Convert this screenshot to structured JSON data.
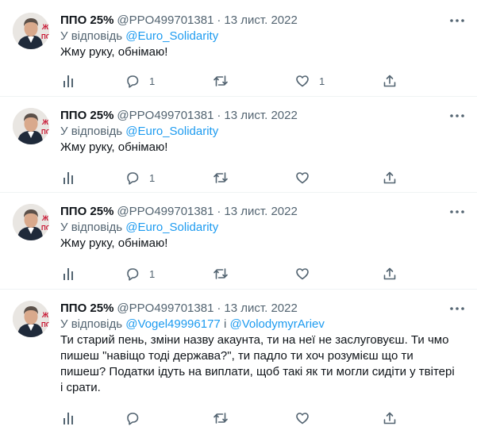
{
  "tweets": [
    {
      "name": "ППО 25%",
      "handle": "@PPO499701381",
      "date": "13 лист. 2022",
      "reply_prefix": "У відповідь",
      "reply_to_1": "@Euro_Solidarity",
      "reply_joiner": "",
      "reply_to_2": "",
      "text": "Жму руку, обнімаю!",
      "reply_count": "1",
      "like_count": "1"
    },
    {
      "name": "ППО 25%",
      "handle": "@PPO499701381",
      "date": "13 лист. 2022",
      "reply_prefix": "У відповідь",
      "reply_to_1": "@Euro_Solidarity",
      "reply_joiner": "",
      "reply_to_2": "",
      "text": "Жму руку, обнімаю!",
      "reply_count": "1",
      "like_count": ""
    },
    {
      "name": "ППО 25%",
      "handle": "@PPO499701381",
      "date": "13 лист. 2022",
      "reply_prefix": "У відповідь",
      "reply_to_1": "@Euro_Solidarity",
      "reply_joiner": "",
      "reply_to_2": "",
      "text": "Жму руку, обнімаю!",
      "reply_count": "1",
      "like_count": ""
    },
    {
      "name": "ППО 25%",
      "handle": "@PPO499701381",
      "date": "13 лист. 2022",
      "reply_prefix": "У відповідь",
      "reply_to_1": "@Vogel49996177",
      "reply_joiner": "і",
      "reply_to_2": "@VolodymyrAriev",
      "text": "Ти старий пень, зміни назву акаунта, ти на неї не заслуговуєш. Ти чмо пишеш \"навіщо тоді держава?\", ти падло ти хоч розумієш що ти пишеш? Податки ідуть на виплати, щоб такі як ти могли сидіти у твітері і срати.",
      "reply_count": "",
      "like_count": ""
    }
  ],
  "avatar": {
    "badge_letters": "Ж ПО",
    "colors": {
      "bg": "#e9e6e2",
      "hair": "#5b5049",
      "skin": "#d9a98c",
      "suit": "#1f2a3a",
      "badge": "#c8102e"
    }
  },
  "icons": {
    "views": "analytics-icon",
    "reply": "reply-icon",
    "retweet": "retweet-icon",
    "like": "heart-icon",
    "share": "share-icon",
    "more": "more-options-icon"
  },
  "colors": {
    "text": "#0f1419",
    "secondary": "#536471",
    "link": "#1d9bf0",
    "divider": "#eff3f4"
  }
}
